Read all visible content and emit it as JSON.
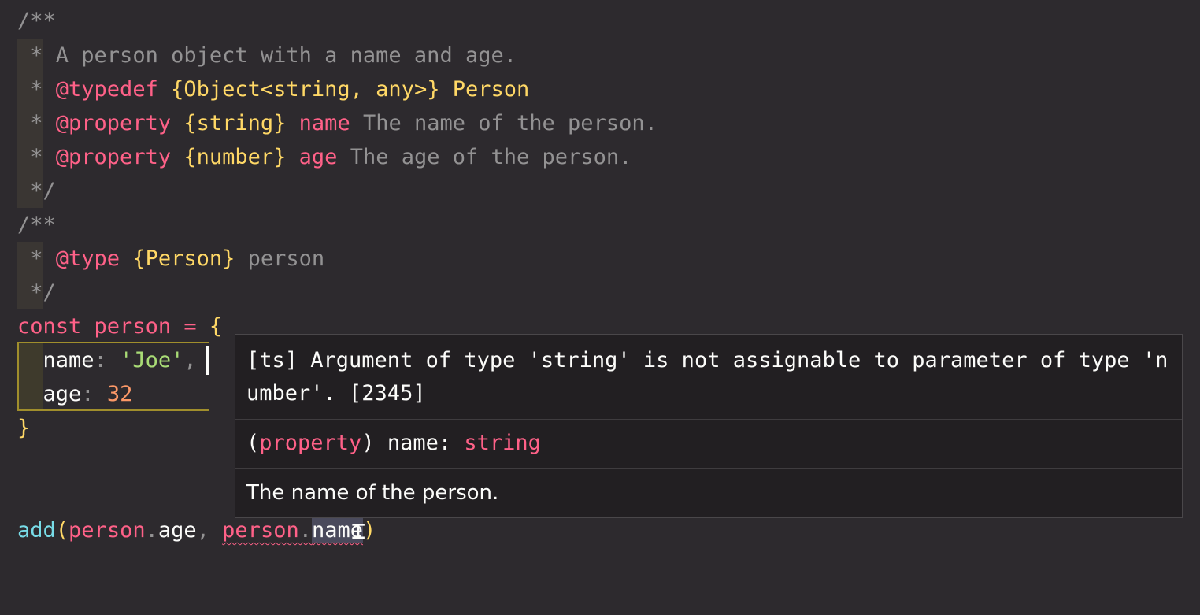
{
  "code": {
    "l1": "/**",
    "l2_star": " * ",
    "l2_text": "A person object with a name and age.",
    "l3_star": " * ",
    "l3_tag": "@typedef",
    "l3_type": "{Object<string, any>}",
    "l3_name": "Person",
    "l4_star": " * ",
    "l4_tag": "@property",
    "l4_type": "{string}",
    "l4_name": "name",
    "l4_desc": "The name of the person.",
    "l5_star": " * ",
    "l5_tag": "@property",
    "l5_type": "{number}",
    "l5_name": "age",
    "l5_desc": "The age of the person.",
    "l6": " */",
    "l7": "/**",
    "l8_star": " * ",
    "l8_tag": "@type",
    "l8_type": "{Person}",
    "l8_name": "person",
    "l9": " */",
    "l10_kw": "const",
    "l10_var": "person",
    "l10_eq": "=",
    "l10_brace": "{",
    "l11_key": "name",
    "l11_colon": ":",
    "l11_str": "'Joe'",
    "l11_comma": ",",
    "l12_key": "age",
    "l12_colon": ":",
    "l12_num": "32",
    "l13_brace": "}",
    "l15_fn": "add",
    "l15_open": "(",
    "l15_obj1": "person",
    "l15_dot1": ".",
    "l15_prop1": "age",
    "l15_comma": ",",
    "l15_obj2": "person",
    "l15_dot2": ".",
    "l15_prop2": "name",
    "l15_close": ")"
  },
  "hover": {
    "message": "[ts] Argument of type 'string' is not assignable to parameter of type 'number'. [2345]",
    "sig_open": "(",
    "sig_kind": "property",
    "sig_close": ")",
    "sig_name": " name: ",
    "sig_type": "string",
    "doc": "The name of the person."
  },
  "colors": {
    "background": "#2d2a2e",
    "keyword": "#ff6188",
    "type": "#ffd866",
    "string": "#a9dc76",
    "number": "#fc9867",
    "function": "#78dce8",
    "comment": "#939293"
  }
}
